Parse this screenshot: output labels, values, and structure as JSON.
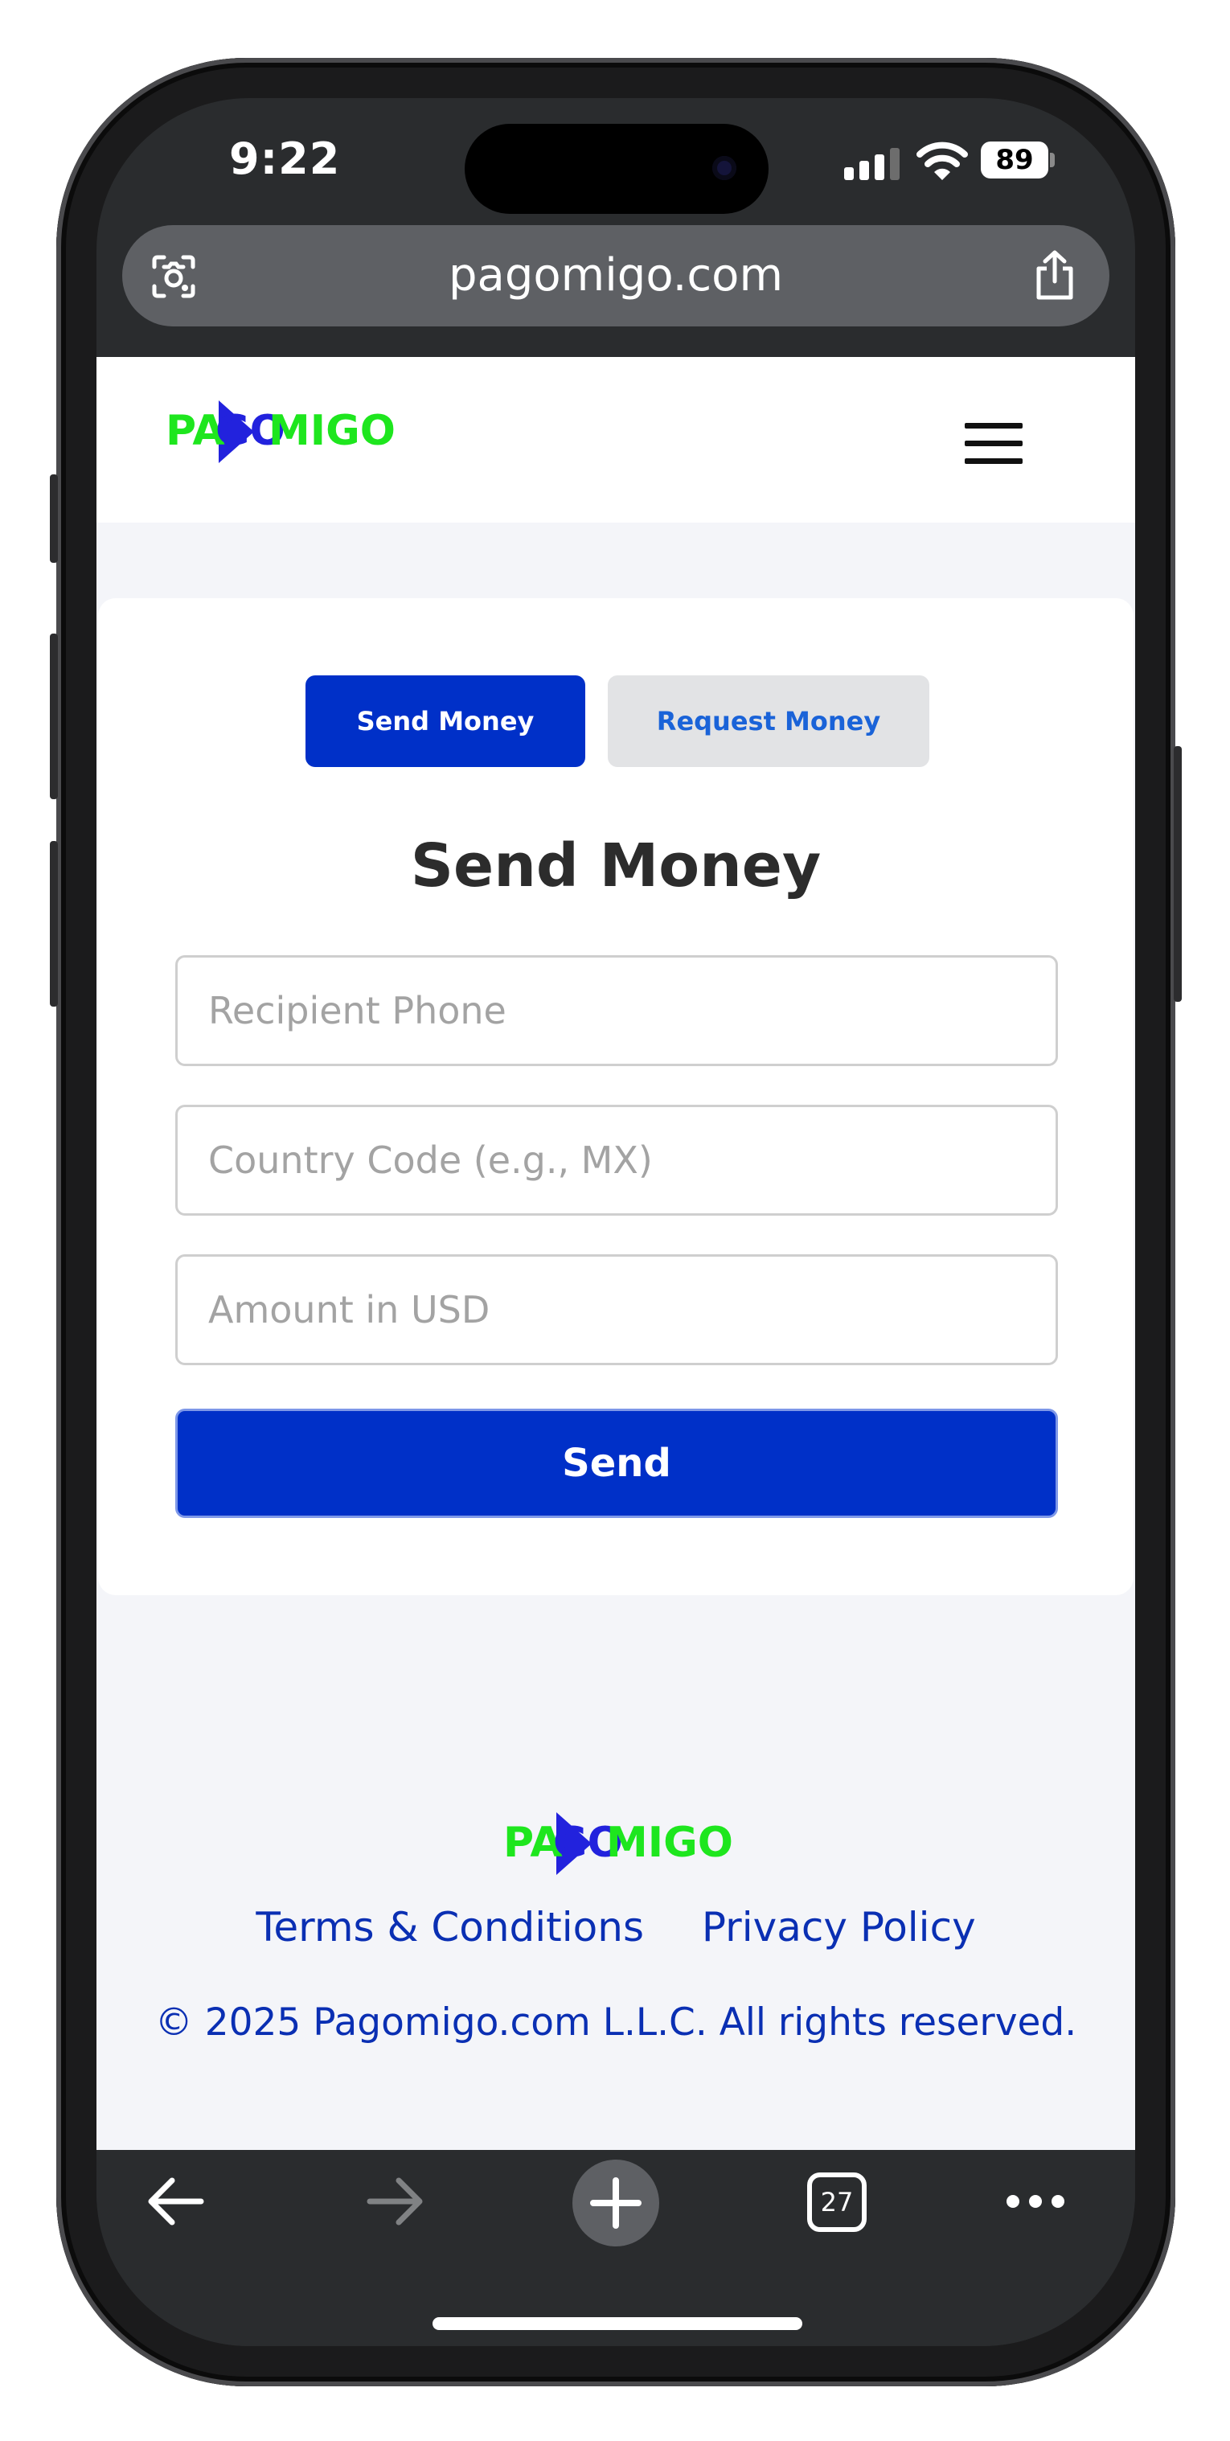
{
  "status_bar": {
    "time": "9:22",
    "battery": "89",
    "icons": [
      "signal-icon",
      "wifi-icon",
      "battery-icon"
    ]
  },
  "browser": {
    "url": "pagomigo.com",
    "icons": [
      "camera-lens-icon",
      "share-icon"
    ]
  },
  "brand": {
    "logo_part1": "PA",
    "logo_part2": "GO",
    "logo_part3": "MIGO",
    "green": "#1ee61e",
    "blue": "#2222dd"
  },
  "header": {
    "menu_icon": "hamburger-menu-icon"
  },
  "tabs": {
    "send": "Send Money",
    "request": "Request Money",
    "active": "send"
  },
  "form": {
    "title": "Send Money",
    "recipient_placeholder": "Recipient Phone",
    "country_placeholder": "Country Code (e.g., MX)",
    "amount_placeholder": "Amount in USD",
    "submit_label": "Send"
  },
  "footer": {
    "terms": "Terms & Conditions",
    "privacy": "Privacy Policy",
    "copyright": "© 2025 Pagomigo.com L.L.C. All rights reserved."
  },
  "toolbar": {
    "tab_count": "27",
    "icons": [
      "back-arrow-icon",
      "forward-arrow-icon",
      "plus-icon",
      "tabs-icon",
      "more-icon"
    ]
  },
  "colors": {
    "primary": "#0030c8",
    "link": "#0a2fb3",
    "page_bg": "#f4f5f9",
    "browser_chrome": "#2a2c2e"
  }
}
